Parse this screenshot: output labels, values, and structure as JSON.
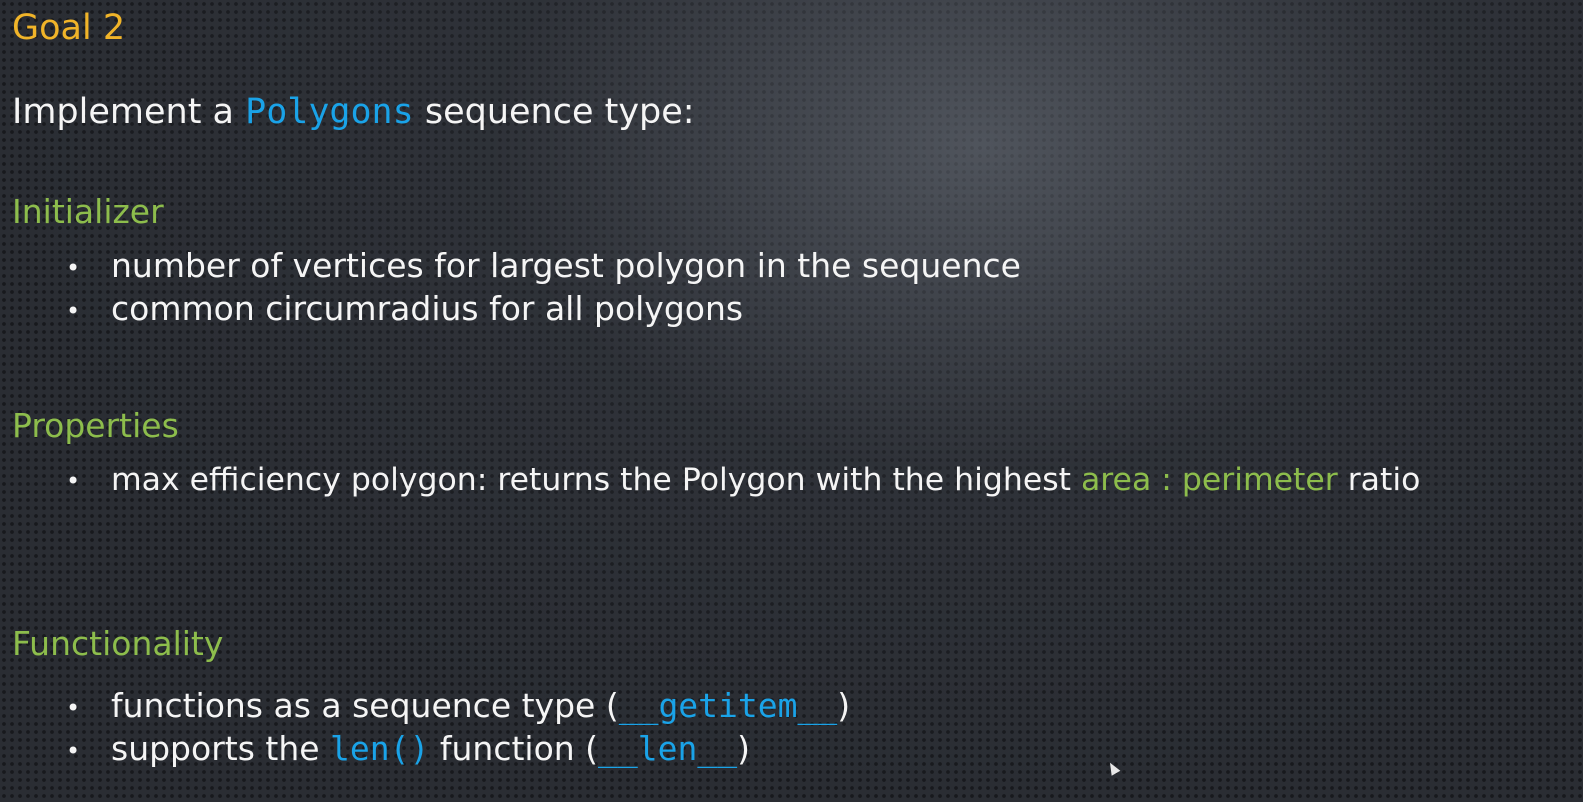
{
  "slide": {
    "title": "Goal 2",
    "intro": {
      "prefix": "Implement a ",
      "code": "Polygons",
      "suffix": " sequence type:"
    },
    "sections": {
      "initializer": {
        "heading": "Initializer",
        "bullets": [
          "number of vertices for largest polygon in the sequence",
          "common circumradius for all polygons"
        ]
      },
      "properties": {
        "heading": "Properties",
        "bullet": {
          "prefix": "max efficiency polygon: returns the Polygon with the highest ",
          "highlight": "area : perimeter",
          "suffix": " ratio"
        }
      },
      "functionality": {
        "heading": "Functionality",
        "bullet1": {
          "prefix": "functions as a sequence type (",
          "code": "__getitem__",
          "suffix": ")"
        },
        "bullet2": {
          "prefix": "supports the ",
          "code1": "len()",
          "middle": " function (",
          "code2": "__len__",
          "suffix": ")"
        }
      }
    },
    "bullet_glyph": "•",
    "colors": {
      "title": "#f0b429",
      "heading": "#8dbd4c",
      "code": "#1aa3e8",
      "text": "#f5f5f5"
    }
  }
}
